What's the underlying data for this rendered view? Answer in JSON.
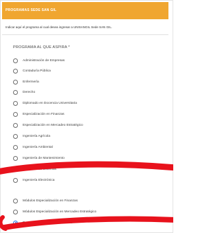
{
  "header": {
    "title": "PROGRAMAS SEDE SAN GIL"
  },
  "description": "Indicar aquí el programa al cual desea ingresar a UNISANGIL Sede SAN GIL.",
  "question": {
    "title": "PROGRAMA AL QUE ASPIRA *"
  },
  "options": [
    {
      "label": "Administración de Empresas",
      "selected": false
    },
    {
      "label": "Contaduría Pública",
      "selected": false
    },
    {
      "label": "Enfermería",
      "selected": false
    },
    {
      "label": "Derecho",
      "selected": false
    },
    {
      "label": "Diplomado en Docencia Universitaria",
      "selected": false
    },
    {
      "label": "Especialización en Finanzas",
      "selected": false
    },
    {
      "label": "Especialización en Mercadeo Estratégico",
      "selected": false
    },
    {
      "label": "Ingeniería Agrícola",
      "selected": false
    },
    {
      "label": "Ingeniería Ambiental",
      "selected": false
    },
    {
      "label": "Ingeniería de Mantenimiento",
      "selected": false
    },
    {
      "label": "Ingeniería de Sistemas",
      "selected": false
    },
    {
      "label": "Ingeniería Electrónica",
      "selected": false
    },
    {
      "label": "Módulos Especialización en Finanzas",
      "selected": false
    },
    {
      "label": "Módulos Especialización en Mercadeo Estratégico",
      "selected": false
    },
    {
      "label": "Programas de formación continua",
      "selected": true
    }
  ],
  "colors": {
    "header_bg": "#f0a630",
    "annotation": "#e8121c",
    "radio_selected": "#1a73e8"
  }
}
